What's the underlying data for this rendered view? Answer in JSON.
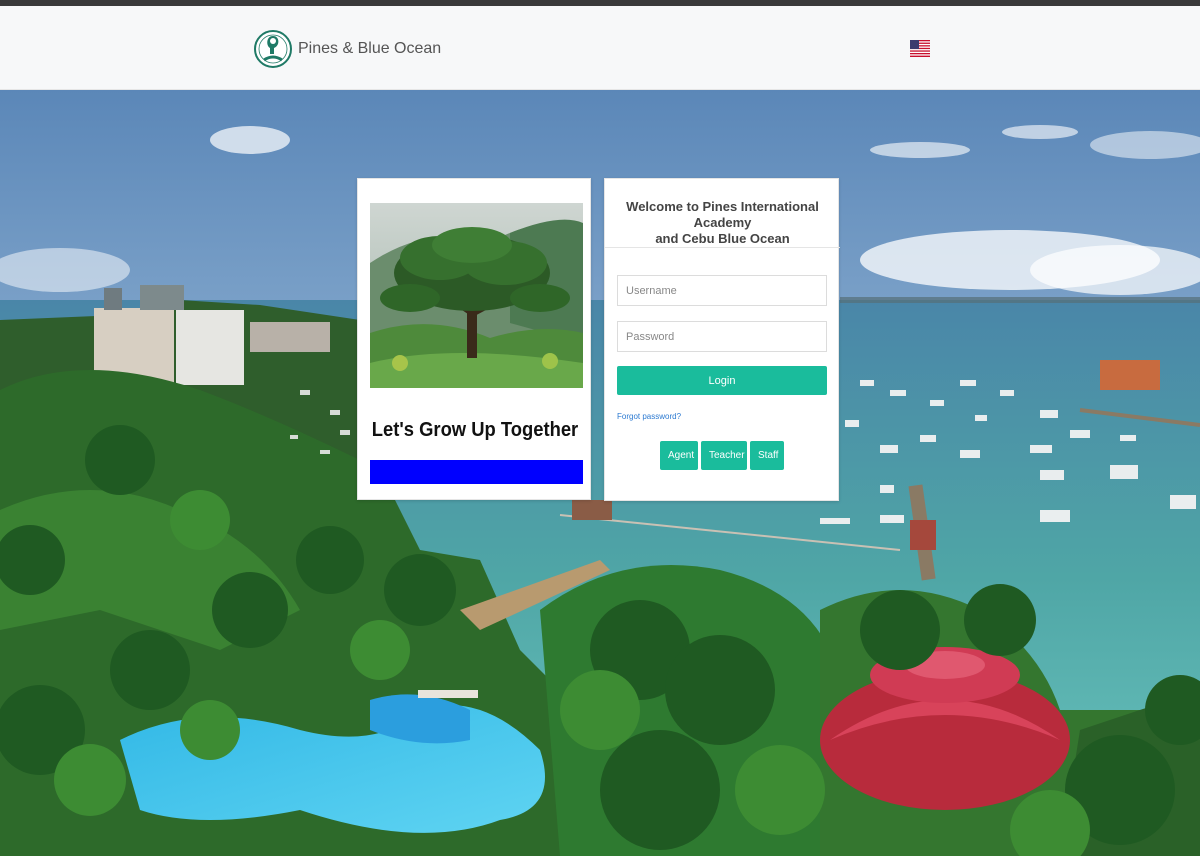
{
  "header": {
    "brand_name": "Pines & Blue Ocean",
    "logo_icon": "pines-academy-logo",
    "language_icon": "us-flag-icon"
  },
  "promo": {
    "tagline": "Let's Grow Up Together",
    "photo_icon": "tree-photo",
    "accent_color": "#0000ff"
  },
  "login": {
    "welcome_line1": "Welcome to Pines International Academy",
    "welcome_line2": "and Cebu Blue Ocean",
    "username_placeholder": "Username",
    "password_placeholder": "Password",
    "login_label": "Login",
    "forgot_label": "Forgot password?",
    "roles": {
      "agent": "Agent",
      "teacher": "Teacher",
      "staff": "Staff"
    },
    "button_color": "#1abc9c"
  },
  "background": {
    "scene": "cebu-coastline-photo"
  }
}
